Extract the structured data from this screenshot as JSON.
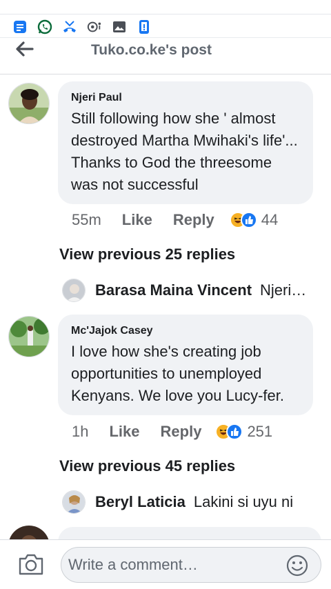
{
  "header": {
    "title": "Tuko.co.ke's post"
  },
  "status_icons": [
    "messages-icon",
    "whatsapp-icon",
    "missed-call-icon",
    "chat-bubble-icon",
    "gallery-icon",
    "phone-frame-icon"
  ],
  "colors": {
    "facebook_blue": "#1877f2",
    "whatsapp_green": "#25d366",
    "bubble_bg": "#f0f2f5",
    "meta_gray": "#65676b"
  },
  "comments": [
    {
      "author": "Njeri Paul",
      "text": "Still following how she ' almost destroyed Martha Mwihaki's life'... Thanks to God the threesome was not successful",
      "time": "55m",
      "like_label": "Like",
      "reply_label": "Reply",
      "reaction_count": "44",
      "reactions": [
        "haha",
        "like"
      ],
      "view_previous": "View previous 25 replies",
      "latest_reply": {
        "author": "Barasa Maina Vincent",
        "text": "Njeri Paul"
      }
    },
    {
      "author": "Mc'Jajok Casey",
      "text": "I love how she's creating job opportunities to unemployed Kenyans. We love you Lucy-fer.",
      "time": "1h",
      "like_label": "Like",
      "reply_label": "Reply",
      "reaction_count": "251",
      "reactions": [
        "haha",
        "like"
      ],
      "view_previous": "View previous 45 replies",
      "latest_reply": {
        "author": "Beryl Laticia",
        "text": "Lakini si uyu ni"
      }
    }
  ],
  "composer": {
    "placeholder": "Write a comment…"
  }
}
